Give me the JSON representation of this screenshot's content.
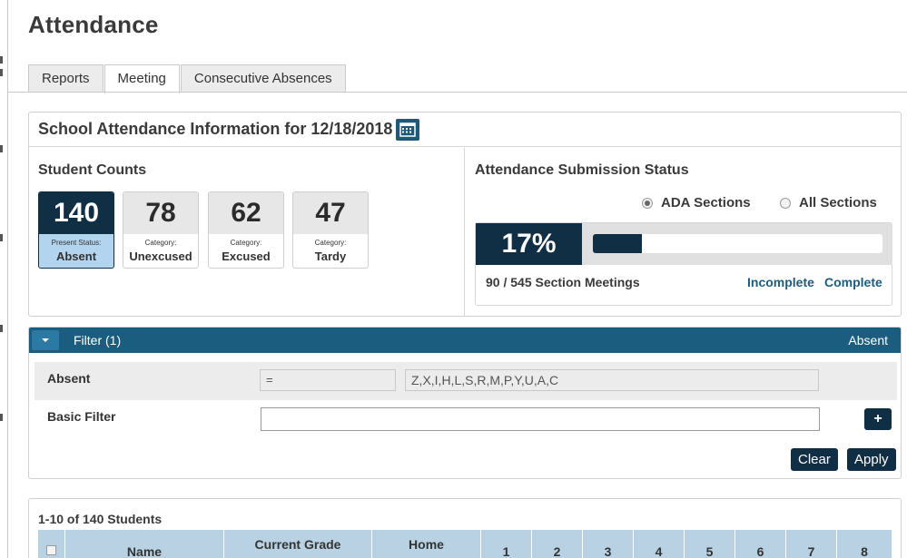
{
  "page": {
    "title": "Attendance"
  },
  "tabs": [
    {
      "label": "Reports",
      "active": false
    },
    {
      "label": "Meeting",
      "active": true
    },
    {
      "label": "Consecutive Absences",
      "active": false
    }
  ],
  "info": {
    "title": "School Attendance Information for 12/18/2018",
    "calendar_icon": "calendar-icon"
  },
  "student_counts": {
    "title": "Student Counts",
    "cards": [
      {
        "value": "140",
        "category": "Present Status:",
        "label": "Absent",
        "selected": true
      },
      {
        "value": "78",
        "category": "Category:",
        "label": "Unexcused",
        "selected": false
      },
      {
        "value": "62",
        "category": "Category:",
        "label": "Excused",
        "selected": false
      },
      {
        "value": "47",
        "category": "Category:",
        "label": "Tardy",
        "selected": false
      }
    ]
  },
  "submission": {
    "title": "Attendance Submission Status",
    "radio_ada": "ADA Sections",
    "radio_all": "All Sections",
    "selected_radio": "ADA Sections",
    "percent": "17%",
    "progress_fraction": 0.17,
    "meetings": "90 / 545 Section Meetings",
    "incomplete": "Incomplete",
    "complete": "Complete"
  },
  "filter": {
    "title": "Filter (1)",
    "right_label": "Absent",
    "row1_label": "Absent",
    "operator": "=",
    "value": "Z,X,I,H,L,S,R,M,P,Y,U,A,C",
    "basic_label": "Basic Filter",
    "basic_value": "",
    "plus": "+",
    "clear": "Clear",
    "apply": "Apply"
  },
  "students": {
    "count_text": "1-10 of 140 Students",
    "columns": [
      "Name",
      "Current Grade Level",
      "Home Room",
      "1",
      "2",
      "3",
      "4",
      "5",
      "6",
      "7",
      "8"
    ]
  },
  "colors": {
    "dark_navy": "#102e44",
    "filter_bar": "#1b5d7e",
    "link": "#1d5b7f",
    "selected_card_bg": "#b3d4ee",
    "table_header": "#b8d2e4"
  }
}
